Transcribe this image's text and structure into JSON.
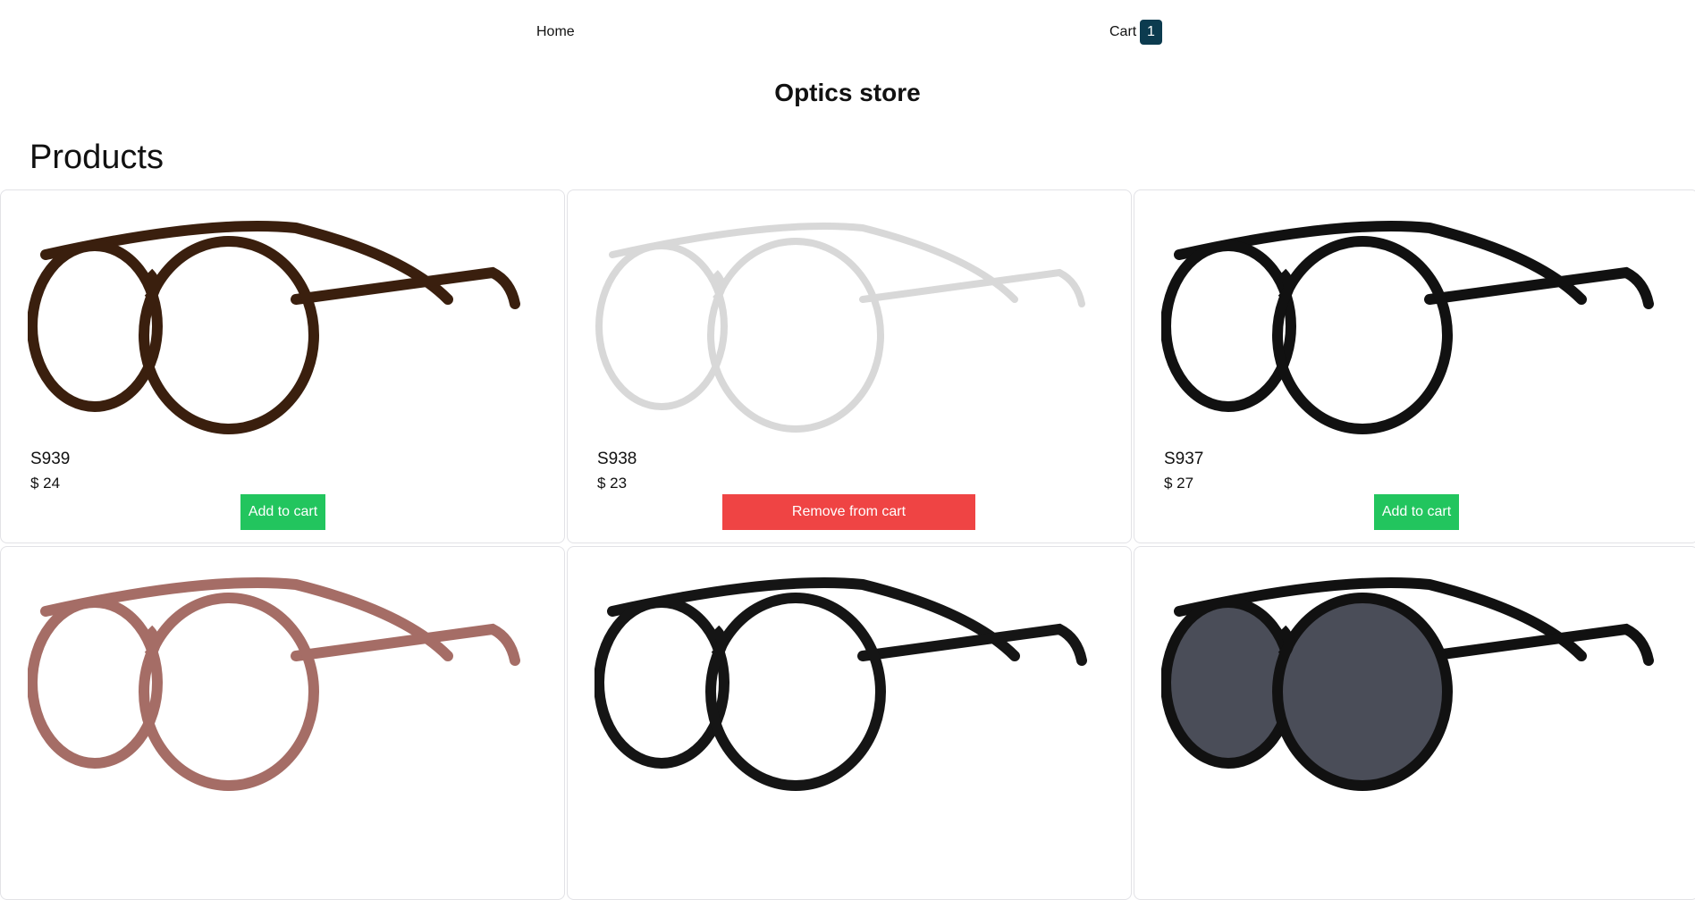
{
  "nav": {
    "home": "Home",
    "cart": "Cart",
    "cart_count": "1"
  },
  "title": "Optics store",
  "section_title": "Products",
  "products": [
    {
      "name": "S939",
      "price": "$ 24",
      "button": "Add to cart",
      "in_cart": false,
      "frame_color": "#3a1f0e",
      "lens_color": "none"
    },
    {
      "name": "S938",
      "price": "$ 23",
      "button": "Remove from cart",
      "in_cart": true,
      "frame_color": "#d8d8d8",
      "lens_color": "none"
    },
    {
      "name": "S937",
      "price": "$ 27",
      "button": "Add to cart",
      "in_cart": false,
      "frame_color": "#111111",
      "lens_color": "none"
    },
    {
      "frame_color": "#a56d66",
      "lens_color": "none"
    },
    {
      "frame_color": "#151515",
      "lens_color": "none"
    },
    {
      "frame_color": "#111111",
      "lens_color": "#4a4d58"
    }
  ]
}
